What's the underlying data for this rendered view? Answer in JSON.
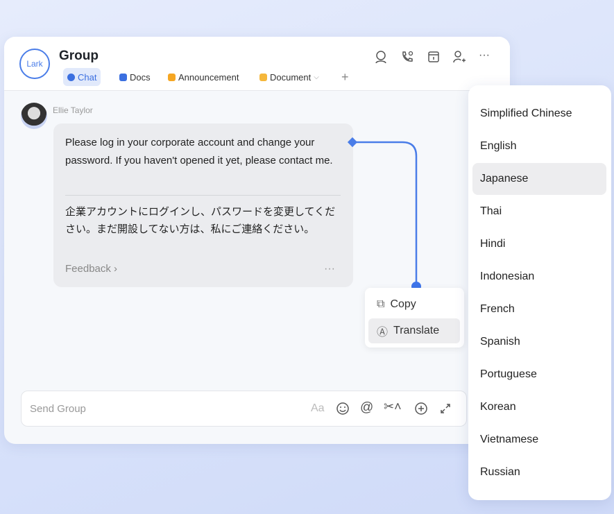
{
  "header": {
    "logo": "Lark",
    "title": "Group",
    "tabs": [
      {
        "label": "Chat",
        "color": "#3b6fe0"
      },
      {
        "label": "Docs",
        "color": "#3b6fe0"
      },
      {
        "label": "Announcement",
        "color": "#f5a623"
      },
      {
        "label": "Document",
        "color": "#f5b73b"
      }
    ],
    "add": "+",
    "more": "···"
  },
  "message": {
    "sender": "Ellie Taylor",
    "original": "Please log in your corporate account and change your password. If you haven't opened it yet, please contact me.",
    "translation": "企業アカウントにログインし、パスワードを変更してください。まだ開設してない方は、私にご連絡ください。",
    "feedback": "Feedback",
    "more": "···"
  },
  "context_menu": {
    "items": [
      "Copy",
      "Translate"
    ],
    "selected": "Translate"
  },
  "languages": {
    "items": [
      "Simplified Chinese",
      "English",
      "Japanese",
      "Thai",
      "Hindi",
      "Indonesian",
      "French",
      "Spanish",
      "Portuguese",
      "Korean",
      "Vietnamese",
      "Russian"
    ],
    "selected": "Japanese"
  },
  "composer": {
    "placeholder": "Send Group",
    "format": "Aa"
  },
  "colors": {
    "accent": "#4a7de8"
  }
}
